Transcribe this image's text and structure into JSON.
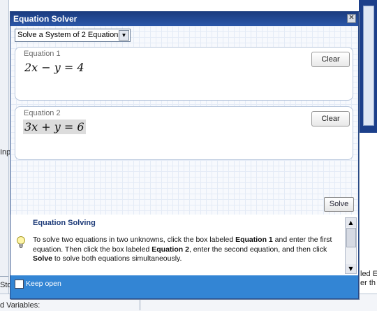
{
  "background": {
    "left_edge_text_1": "Inp",
    "left_edge_text_2": "Sto",
    "bottom_text": "d Variables:",
    "right_edge_text_1": "led E",
    "right_edge_text_2": "er th"
  },
  "dialog": {
    "title": "Equation Solver",
    "close_symbol": "✕"
  },
  "mode": {
    "selected": "Solve a System of 2 Equations",
    "arrow": "▼"
  },
  "equations": [
    {
      "label": "Equation 1",
      "value": "2x − y = 4",
      "clear_label": "Clear"
    },
    {
      "label": "Equation 2",
      "value": "3x + y = 6",
      "clear_label": "Clear"
    }
  ],
  "solve_label": "Solve",
  "help": {
    "title": "Equation Solving",
    "text_1": "To solve two equations in two unknowns, click the box labeled ",
    "bold_1": "Equation 1",
    "text_2": " and enter the first equation. Then click the box labeled ",
    "bold_2": "Equation 2",
    "text_3": ", enter the second equation, and then click ",
    "bold_3": "Solve",
    "text_4": "  to solve both equations simultaneously.",
    "scroll_up": "▲",
    "scroll_down": "▼"
  },
  "footer": {
    "keep_open_label": "Keep open",
    "keep_open_checked": false
  },
  "colors": {
    "titlebar": "#1b3c80",
    "footer": "#3385d4",
    "help_title": "#1c3a78"
  }
}
